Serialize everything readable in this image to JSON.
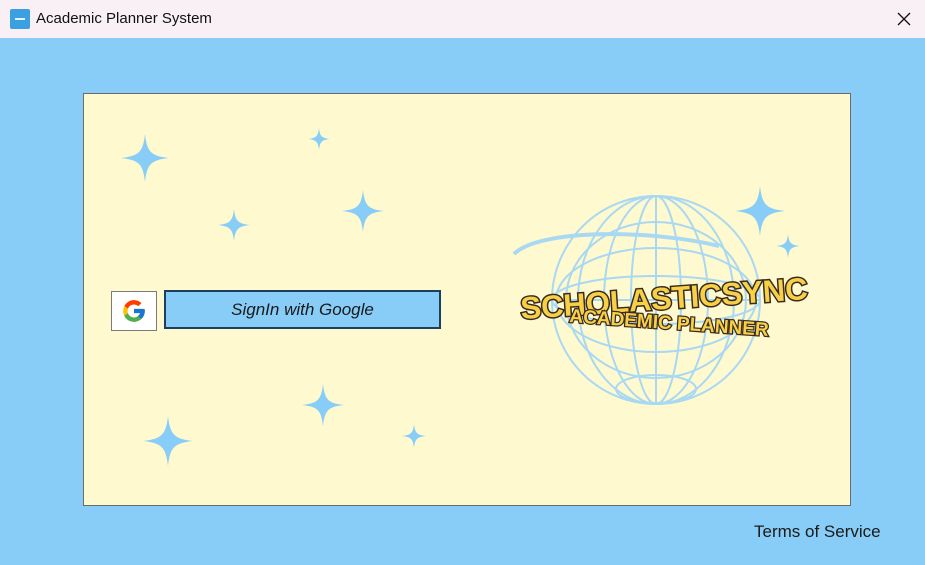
{
  "window": {
    "title": "Academic Planner System",
    "app_icon": "app-icon",
    "close_icon": "close-icon"
  },
  "login": {
    "google_icon": "google-g-icon",
    "signin_label": "SignIn with Google"
  },
  "logo": {
    "line1": "SCHOLASTICSYNC",
    "line2": "ACADEMIC PLANNER",
    "icon": "globe-icon"
  },
  "footer": {
    "terms_label": "Terms of Service"
  },
  "colors": {
    "background": "#87cdf7",
    "panel": "#fef9cf",
    "sparkle": "#87cdf7",
    "logo_text": "#f7d046",
    "logo_outline": "#3a2b1f"
  }
}
